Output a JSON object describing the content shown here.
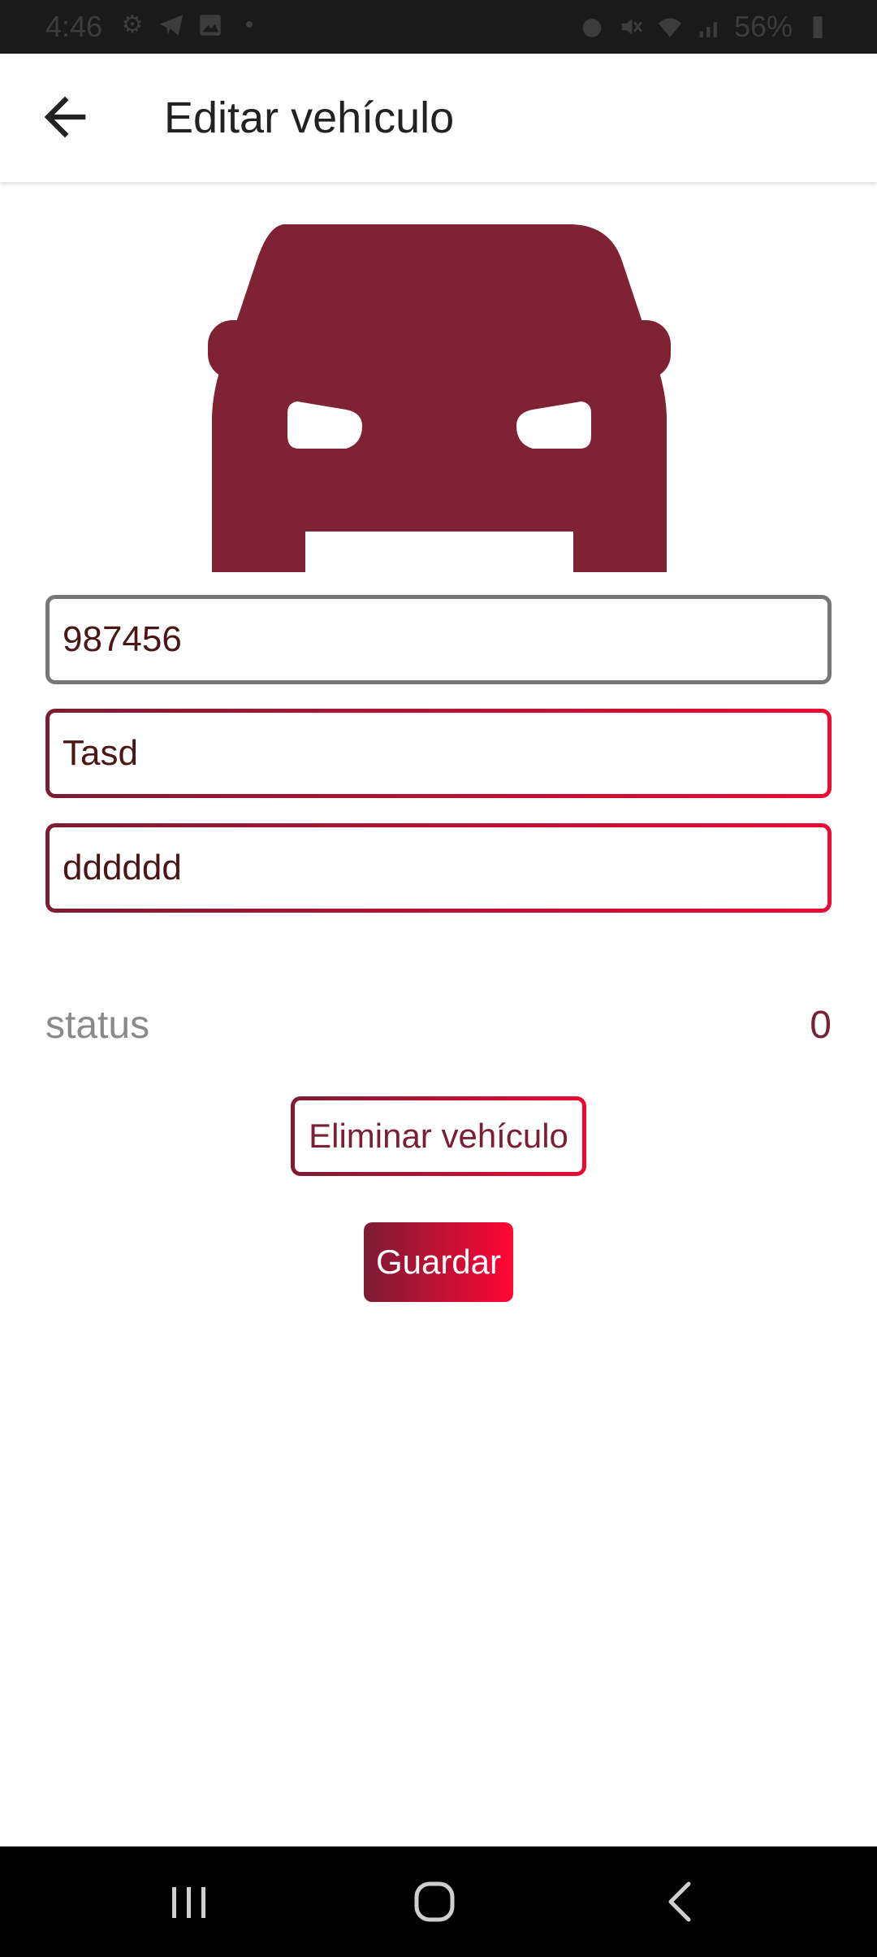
{
  "status_bar": {
    "time": "4:46",
    "battery_percent": "56%",
    "left_icons": [
      "settings-icon",
      "telegram-icon",
      "gallery-icon",
      "dot-icon"
    ],
    "right_icons": [
      "alarm-icon",
      "mute-icon",
      "wifi-icon",
      "signal-icon",
      "battery-icon"
    ]
  },
  "header": {
    "title": "Editar vehículo",
    "back_icon": "arrow-left-icon"
  },
  "vehicle_image": {
    "icon": "car-icon",
    "color": "#7f2233"
  },
  "form": {
    "plate_value": "987456",
    "brand_value": "Tasd",
    "model_value": "dddddd"
  },
  "status_row": {
    "label": "status",
    "value": "0"
  },
  "actions": {
    "delete_label": "Eliminar vehículo",
    "save_label": "Guardar"
  },
  "colors": {
    "accent_dark": "#7c1c33",
    "accent_bright": "#ee0a32",
    "neutral_border": "#777777"
  },
  "nav_bar": {
    "recents_icon": "recents-icon",
    "home_icon": "home-icon",
    "back_icon": "nav-back-icon"
  }
}
